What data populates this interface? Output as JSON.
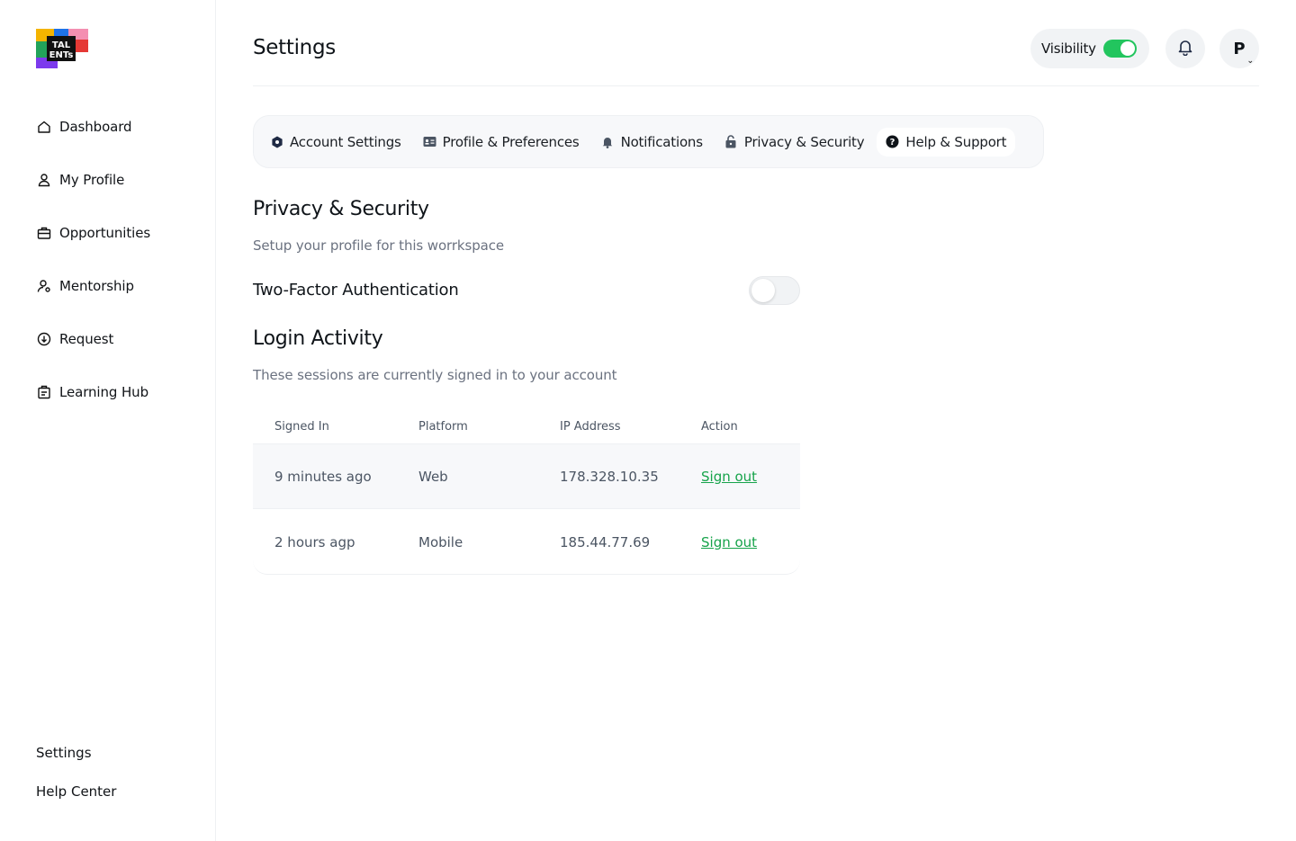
{
  "sidebar": {
    "items": [
      {
        "label": "Dashboard"
      },
      {
        "label": "My Profile"
      },
      {
        "label": "Opportunities"
      },
      {
        "label": "Mentorship"
      },
      {
        "label": "Request"
      },
      {
        "label": "Learning Hub"
      }
    ],
    "bottom": [
      {
        "label": "Settings"
      },
      {
        "label": "Help Center"
      }
    ]
  },
  "header": {
    "title": "Settings",
    "visibility_label": "Visibility",
    "visibility_on": true,
    "avatar_initial": "P"
  },
  "tabs": [
    {
      "label": "Account Settings",
      "icon": "hexagon-icon"
    },
    {
      "label": "Profile & Preferences",
      "icon": "id-card-icon"
    },
    {
      "label": "Notifications",
      "icon": "bell-icon"
    },
    {
      "label": "Privacy & Security",
      "icon": "lock-icon"
    },
    {
      "label": "Help & Support",
      "icon": "help-circle-icon",
      "active": true
    }
  ],
  "privacy": {
    "title": "Privacy & Security",
    "subtitle": "Setup your profile for this worrkspace",
    "two_factor_label": "Two-Factor Authentication",
    "two_factor_enabled": false
  },
  "login_activity": {
    "title": "Login Activity",
    "subtitle": "These sessions are currently signed in to your account",
    "columns": [
      "Signed In",
      "Platform",
      "IP Address",
      "Action"
    ],
    "rows": [
      {
        "signed_in": "9 minutes ago",
        "platform": "Web",
        "ip": "178.328.10.35",
        "action": "Sign out"
      },
      {
        "signed_in": "2 hours agp",
        "platform": "Mobile",
        "ip": "185.44.77.69",
        "action": "Sign out"
      }
    ]
  },
  "colors": {
    "accent_green": "#22c55e",
    "link_green": "#16a34a"
  }
}
